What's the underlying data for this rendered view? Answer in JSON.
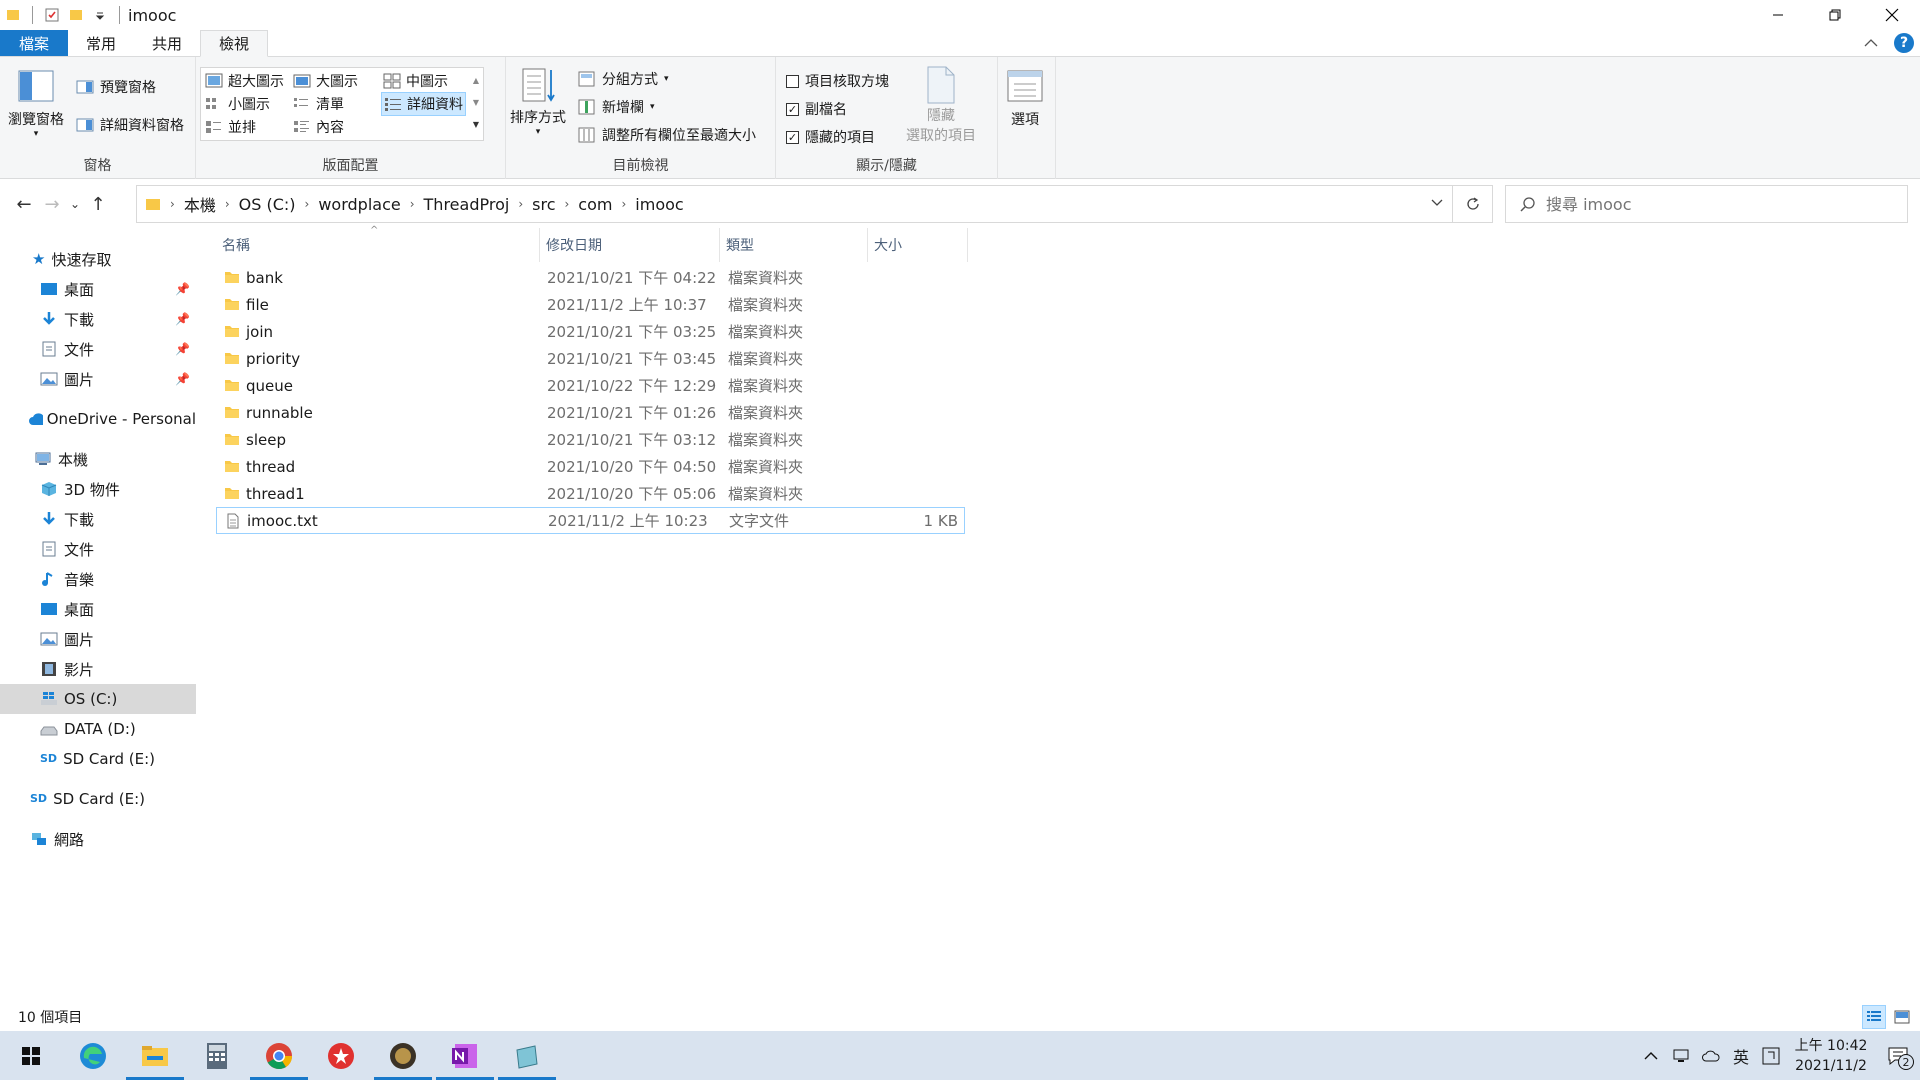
{
  "window": {
    "title": "imooc"
  },
  "ribbon_tabs": [
    "檔案",
    "常用",
    "共用",
    "檢視"
  ],
  "ribbon": {
    "pane_group": {
      "label": "窗格",
      "nav_pane": "瀏覽窗格",
      "preview_pane": "預覽窗格",
      "details_pane": "詳細資料窗格"
    },
    "layout_group": {
      "label": "版面配置",
      "extra_large_icons": "超大圖示",
      "large_icons": "大圖示",
      "medium_icons": "中圖示",
      "small_icons": "小圖示",
      "list": "清單",
      "details": "詳細資料",
      "tiles": "並排",
      "content": "內容"
    },
    "current_view_group": {
      "label": "目前檢視",
      "sort_by": "排序方式",
      "group_by": "分組方式",
      "add_columns": "新增欄",
      "size_columns": "調整所有欄位至最適大小"
    },
    "show_hide_group": {
      "label": "顯示/隱藏",
      "item_checkboxes": "項目核取方塊",
      "file_extensions": "副檔名",
      "hidden_items": "隱藏的項目",
      "hide_selected_line1": "隱藏",
      "hide_selected_line2": "選取的項目"
    },
    "options_group": {
      "options": "選項"
    }
  },
  "checkboxes": {
    "item_checkboxes": false,
    "file_extensions": true,
    "hidden_items": true
  },
  "breadcrumb": [
    "本機",
    "OS (C:)",
    "wordplace",
    "ThreadProj",
    "src",
    "com",
    "imooc"
  ],
  "search": {
    "placeholder": "搜尋 imooc"
  },
  "nav_pane": {
    "quick_access": "快速存取",
    "quick_items": [
      "桌面",
      "下載",
      "文件",
      "圖片"
    ],
    "onedrive": "OneDrive - Personal",
    "this_pc": "本機",
    "pc_items": [
      "3D 物件",
      "下載",
      "文件",
      "音樂",
      "桌面",
      "圖片",
      "影片",
      "OS (C:)",
      "DATA (D:)",
      "SD Card (E:)"
    ],
    "sd_card": "SD Card (E:)",
    "network": "網路"
  },
  "columns": {
    "name": "名稱",
    "date": "修改日期",
    "type": "類型",
    "size": "大小"
  },
  "files": [
    {
      "name": "bank",
      "date": "2021/10/21 下午 04:22",
      "type": "檔案資料夾",
      "size": "",
      "kind": "folder"
    },
    {
      "name": "file",
      "date": "2021/11/2 上午 10:37",
      "type": "檔案資料夾",
      "size": "",
      "kind": "folder"
    },
    {
      "name": "join",
      "date": "2021/10/21 下午 03:25",
      "type": "檔案資料夾",
      "size": "",
      "kind": "folder"
    },
    {
      "name": "priority",
      "date": "2021/10/21 下午 03:45",
      "type": "檔案資料夾",
      "size": "",
      "kind": "folder"
    },
    {
      "name": "queue",
      "date": "2021/10/22 下午 12:29",
      "type": "檔案資料夾",
      "size": "",
      "kind": "folder"
    },
    {
      "name": "runnable",
      "date": "2021/10/21 下午 01:26",
      "type": "檔案資料夾",
      "size": "",
      "kind": "folder"
    },
    {
      "name": "sleep",
      "date": "2021/10/21 下午 03:12",
      "type": "檔案資料夾",
      "size": "",
      "kind": "folder"
    },
    {
      "name": "thread",
      "date": "2021/10/20 下午 04:50",
      "type": "檔案資料夾",
      "size": "",
      "kind": "folder"
    },
    {
      "name": "thread1",
      "date": "2021/10/20 下午 05:06",
      "type": "檔案資料夾",
      "size": "",
      "kind": "folder"
    },
    {
      "name": "imooc.txt",
      "date": "2021/11/2 上午 10:23",
      "type": "文字文件",
      "size": "1 KB",
      "kind": "text"
    }
  ],
  "status": {
    "item_count": "10 個項目"
  },
  "taskbar": {
    "ime": "英",
    "time": "上午 10:42",
    "date": "2021/11/2",
    "notifications": "2"
  },
  "colors": {
    "accent": "#1979ca",
    "selection_bg": "#cce8ff",
    "selection_border": "#99d1ff",
    "folder": "#f8c847",
    "taskbar": "#d9e3ef"
  }
}
